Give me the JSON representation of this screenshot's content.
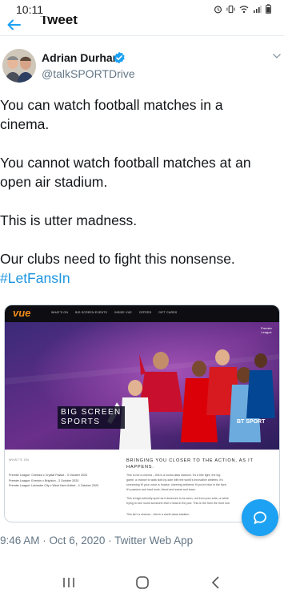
{
  "status_bar": {
    "time": "10:11",
    "icons": [
      "alarm-icon",
      "vibrate-icon",
      "wifi-icon",
      "signal-icon",
      "battery-icon"
    ]
  },
  "header": {
    "title": "Tweet",
    "back_icon": "back-arrow-icon"
  },
  "author": {
    "name": "Adrian Durham",
    "handle": "@talkSPORTDrive",
    "verified": true
  },
  "tweet": {
    "lines": [
      "You can watch football matches in a",
      "cinema.",
      "",
      "You cannot watch football matches at an",
      "open air stadium.",
      "",
      "This is utter madness.",
      "",
      "Our clubs need to fight this nonsense."
    ],
    "hashtag": "#LetFansIn"
  },
  "media": {
    "logo": "vue",
    "nav_items": [
      "WHAT'S ON",
      "BIG SCREEN EVENTS",
      "INSIDE VUE",
      "OFFERS",
      "GIFT CARDS"
    ],
    "hero_line1": "BIG SCREEN",
    "hero_line2": "SPORTS",
    "bt_sport": "BT SPORT",
    "premier_league": "Premier League",
    "whats_on": "WHAT'S ON",
    "fixtures": [
      "Premier League: Chelsea v Crystal Palace - 3 October 2020",
      "Premier League: Everton v Brighton - 3 October 2020",
      "Premier League: Leicester City v West Ham United - 4 October 2020"
    ],
    "heading_line1": "BRINGING YOU CLOSER TO THE ACTION, AS IT",
    "heading_line2": "HAPPENS.",
    "paragraphs": [
      [
        "This is not a cinema – this is a world-class stadium. It's a title fight, the big",
        "game, a chance to walk side-by-side with the world's innovative athletes. It's",
        "screaming 'til your voice is hoarse, cheering anthems 'til you're blue in the face.",
        "It's passion and hard work, blood and sweat and tears."
      ],
      [
        "This is high-intensity sport as it deserves to be seen, not from your sofa, or while",
        "trying to see round someone else's head in the pub. This is the from the front row."
      ],
      [
        "This isn't a cinema – this is a world-class stadium."
      ]
    ]
  },
  "timestamp": "9:46 AM · Oct 6, 2020 · Twitter Web App",
  "fab_icon": "reply-bubble-icon",
  "nav_bar": {
    "recents_icon": "recents-icon",
    "home_icon": "home-icon",
    "back_icon": "back-chevron-icon"
  },
  "colors": {
    "accent": "#1da1f2",
    "hashtag": "#1b95e0",
    "secondary_text": "#657786",
    "vue_orange": "#f08a1c"
  }
}
